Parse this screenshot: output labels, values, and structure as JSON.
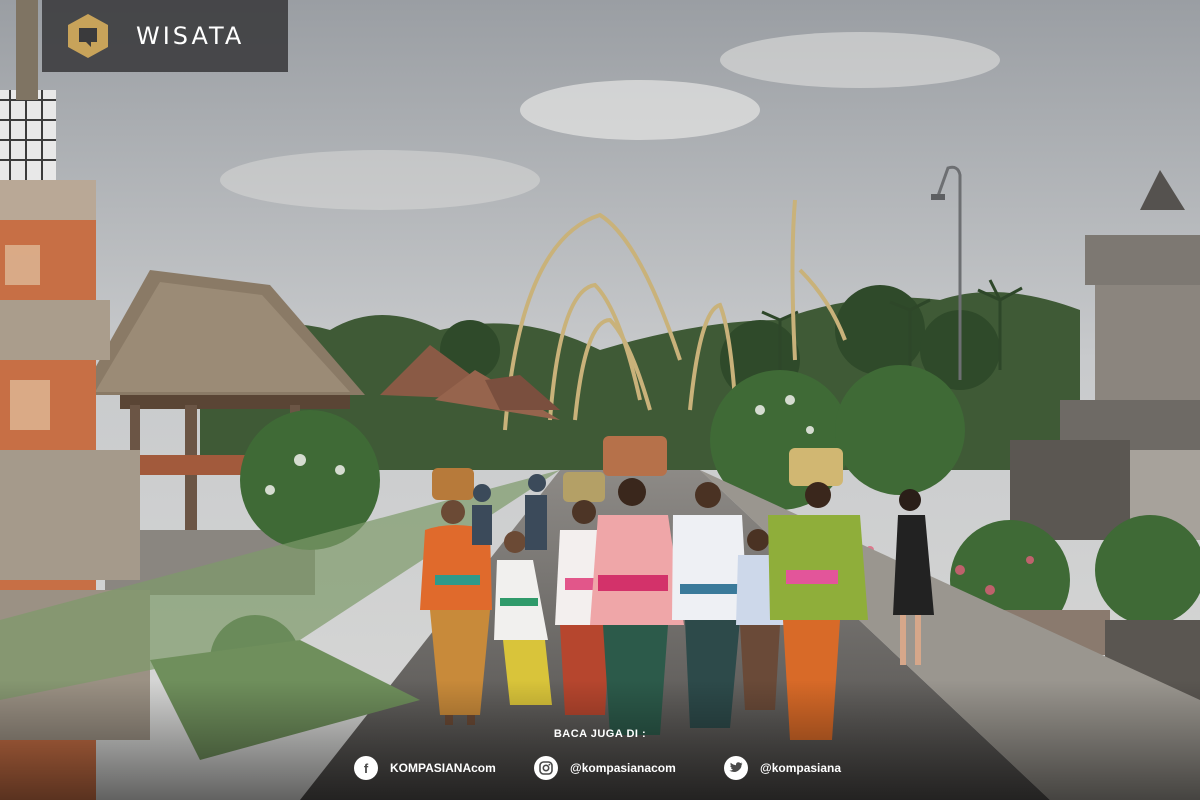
{
  "category_label": "WISATA",
  "footer": {
    "read_also": "BACA JUGA DI :",
    "facebook": {
      "icon": "facebook-icon",
      "label": "KOMPASIANAcom"
    },
    "instagram": {
      "icon": "instagram-icon",
      "label": "@kompasianacom"
    },
    "twitter": {
      "icon": "twitter-icon",
      "label": "@kompasiana"
    }
  },
  "colors": {
    "tag_bg": "#3a3a3c",
    "logo_gold": "#c8a35a",
    "text": "#ffffff"
  }
}
